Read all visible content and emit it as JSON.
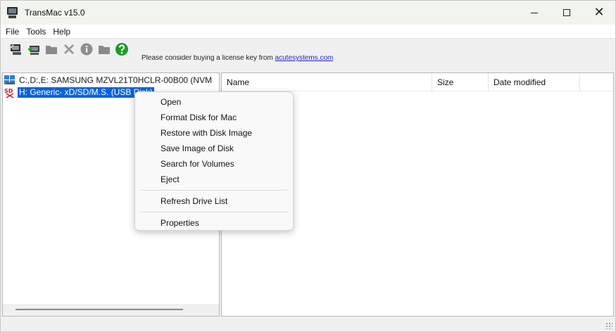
{
  "window": {
    "title": "TransMac v15.0",
    "controls": {
      "minimize": "minimize",
      "maximize": "maximize",
      "close": "✕"
    }
  },
  "menubar": {
    "items": [
      "File",
      "Tools",
      "Help"
    ]
  },
  "toolbar": {
    "icons": [
      "open-disk-icon",
      "save-disk-icon",
      "folder-icon",
      "delete-icon",
      "info-icon",
      "new-folder-icon",
      "help-icon"
    ],
    "banner_text": "Please consider buying a license key from ",
    "banner_link": "acutesystems.com"
  },
  "tree": {
    "items": [
      {
        "label": "C:,D:,E:  SAMSUNG MZVL21T0HCLR-00B00 (NVM",
        "icon": "windows-drive-icon",
        "selected": false
      },
      {
        "label": "H: Generic- xD/SD/M.S. (USB Disk)",
        "icon": "sd-card-icon",
        "selected": true
      }
    ]
  },
  "file_list": {
    "columns": [
      "Name",
      "Size",
      "Date modified"
    ]
  },
  "context_menu": {
    "items": [
      "Open",
      "Format Disk for Mac",
      "Restore with Disk Image",
      "Save Image of Disk",
      "Search for Volumes",
      "Eject"
    ],
    "items2": [
      "Refresh Drive List"
    ],
    "items3": [
      "Properties"
    ]
  },
  "colors": {
    "selection": "#0a64d8",
    "title_bar": "#f1f5ee",
    "help_icon": "#1d9a2a",
    "link": "#1f1fd8"
  }
}
